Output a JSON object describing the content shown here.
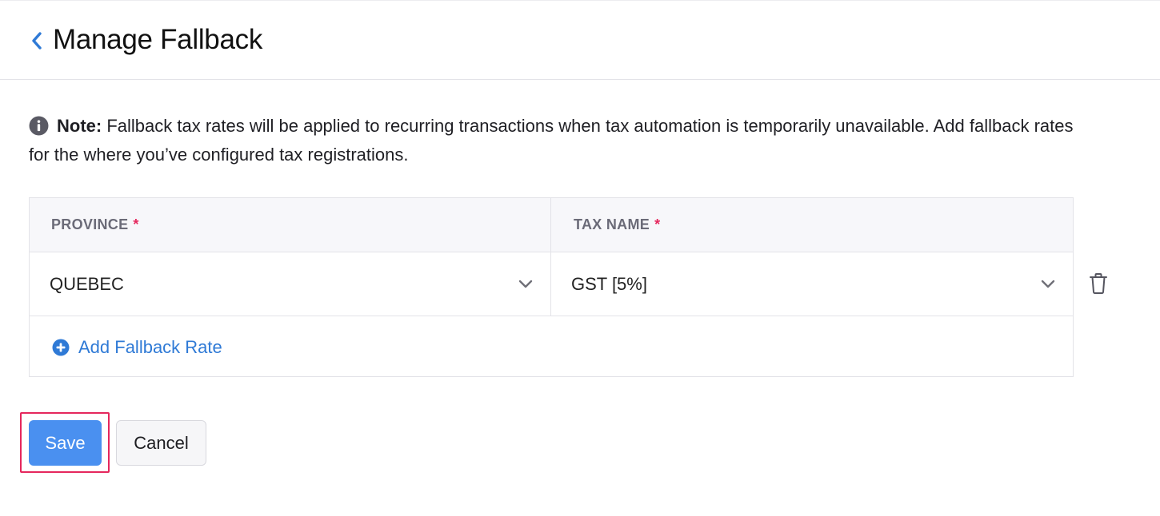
{
  "header": {
    "title": "Manage Fallback",
    "back_icon": "chevron-left-icon"
  },
  "note": {
    "label": "Note:",
    "text": " Fallback tax rates will be applied to recurring transactions when tax automation is temporarily unavailable. Add fallback rates for the where you’ve configured tax registrations.",
    "icon": "info-icon"
  },
  "table": {
    "columns": [
      {
        "label": "PROVINCE",
        "required_mark": "*"
      },
      {
        "label": "TAX NAME",
        "required_mark": "*"
      }
    ],
    "rows": [
      {
        "province": "QUEBEC",
        "tax_name": "GST [5%]"
      }
    ],
    "add_label": "Add Fallback Rate"
  },
  "actions": {
    "save_label": "Save",
    "cancel_label": "Cancel"
  },
  "colors": {
    "accent": "#4a90f0",
    "link": "#2f7ad6",
    "required": "#e5275d",
    "highlight_outline": "#e5275d"
  }
}
